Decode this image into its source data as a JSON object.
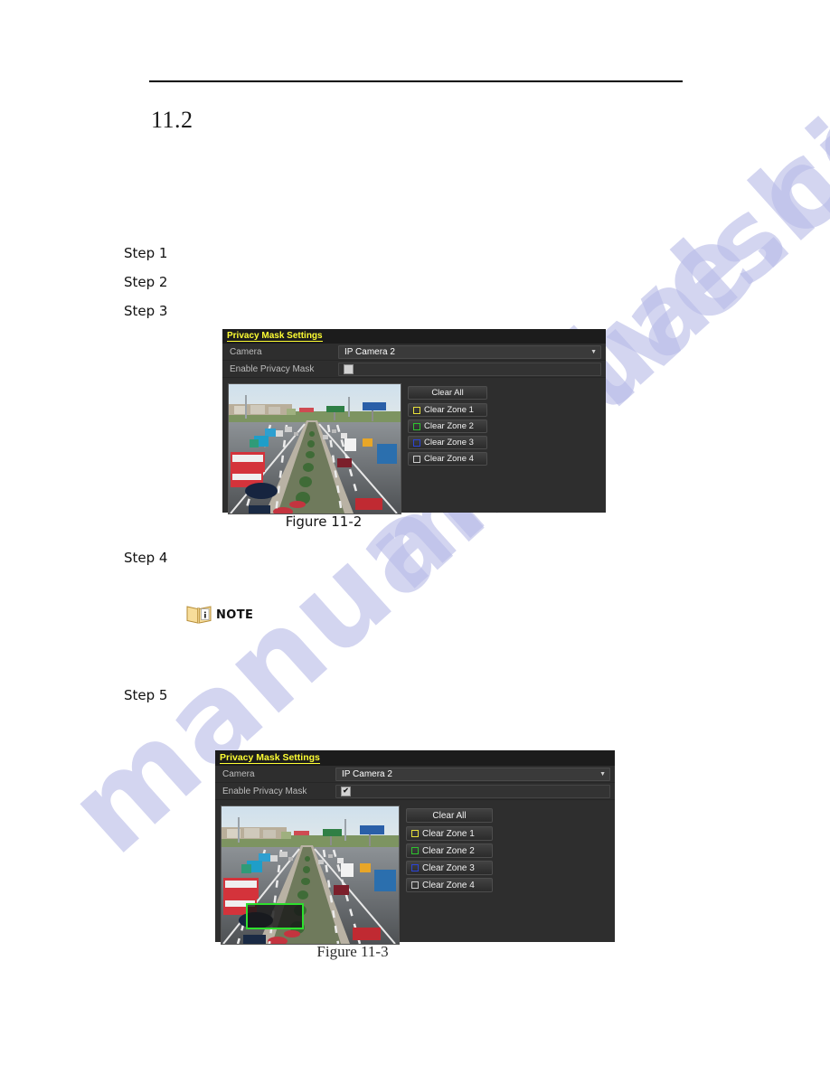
{
  "document": {
    "section_number": "11.2",
    "steps": [
      {
        "label": "Step 1"
      },
      {
        "label": "Step 2"
      },
      {
        "label": "Step 3"
      },
      {
        "label": "Step 4"
      },
      {
        "label": "Step 5"
      }
    ],
    "note": {
      "label": "NOTE",
      "icon": "open-book-info-icon"
    },
    "captions": {
      "figure_1": "Figure 11-2",
      "figure_2": "Figure 11-3"
    },
    "watermark": {
      "text": "manualshive.com",
      "color": "#b9bce8"
    }
  },
  "figure_1": {
    "title": "Privacy Mask Settings",
    "title_color": "#ffff33",
    "camera": {
      "label": "Camera",
      "value": "IP Camera 2",
      "chevron": "chevron-down-icon"
    },
    "enable_privacy_mask": {
      "label": "Enable Privacy Mask",
      "checked": false,
      "check_glyph": ""
    },
    "clear_all": {
      "label": "Clear All"
    },
    "zones": [
      {
        "label": "Clear Zone 1",
        "color": "#e8e03a"
      },
      {
        "label": "Clear Zone 2",
        "color": "#2ec42e"
      },
      {
        "label": "Clear Zone 3",
        "color": "#2b44d8"
      },
      {
        "label": "Clear Zone 4",
        "color": "#cccccc"
      }
    ],
    "mask_drawn": false
  },
  "figure_2": {
    "title": "Privacy Mask Settings",
    "title_color": "#ffff33",
    "camera": {
      "label": "Camera",
      "value": "IP Camera 2",
      "chevron": "chevron-down-icon"
    },
    "enable_privacy_mask": {
      "label": "Enable Privacy Mask",
      "checked": true,
      "check_glyph": "✔"
    },
    "clear_all": {
      "label": "Clear All"
    },
    "zones": [
      {
        "label": "Clear Zone 1",
        "color": "#e8e03a"
      },
      {
        "label": "Clear Zone 2",
        "color": "#2ec42e"
      },
      {
        "label": "Clear Zone 3",
        "color": "#2b44d8"
      },
      {
        "label": "Clear Zone 4",
        "color": "#cccccc"
      }
    ],
    "mask_drawn": true,
    "mask_color": "#2ee02e"
  }
}
